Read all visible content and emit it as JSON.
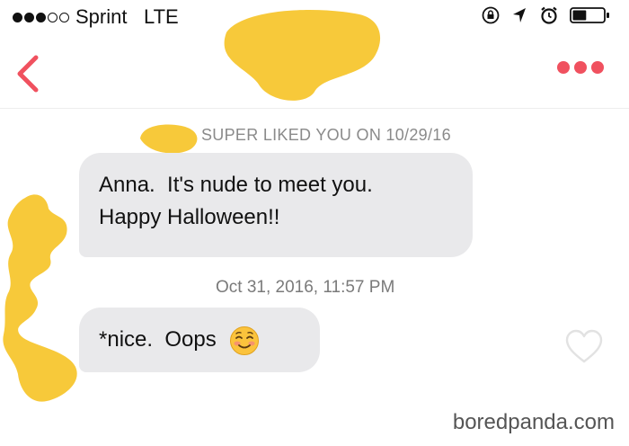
{
  "status_bar": {
    "carrier": "Sprint",
    "network": "LTE",
    "signal_bars_filled": 3,
    "signal_bars_total": 5,
    "battery_level": 0.45
  },
  "conversation": {
    "super_like_notice": "SUPER LIKED YOU ON 10/29/16",
    "messages": [
      {
        "lines": [
          "Anna.  It's nude to meet you.",
          "Happy Halloween!!"
        ]
      },
      {
        "text": "*nice.  Oops",
        "emoji": "smiling-face-icon"
      }
    ],
    "timestamp": "Oct 31, 2016, 11:57 PM"
  },
  "watermark": "boredpanda.com",
  "colors": {
    "accent": "#f0515f",
    "bubble": "#e9e9eb",
    "redaction": "#f7c93a"
  }
}
